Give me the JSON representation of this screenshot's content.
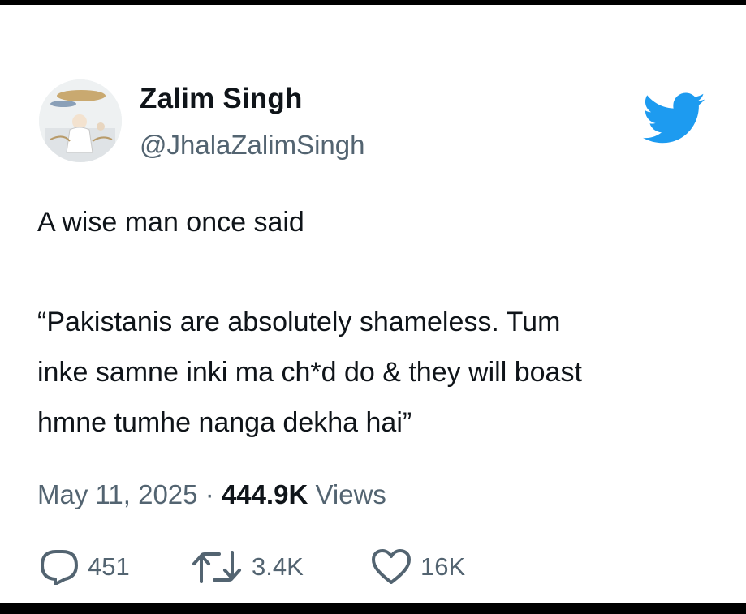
{
  "author": {
    "display_name": "Zalim Singh",
    "handle": "@JhalaZalimSingh",
    "avatar_icon": "avatar-painting"
  },
  "brand": {
    "icon": "twitter-bird-icon",
    "color": "#1d9bf0"
  },
  "tweet": {
    "lines": [
      "A wise man once said",
      "“Pakistanis are absolutely shameless. Tum",
      "inke samne inki ma ch*d do & they will boast",
      "hmne tumhe nanga dekha hai”"
    ]
  },
  "meta": {
    "date": "May 11, 2025",
    "separator": "·",
    "views_count": "444.9K",
    "views_label": "Views"
  },
  "actions": {
    "replies": "451",
    "retweets": "3.4K",
    "likes": "16K"
  },
  "colors": {
    "text_primary": "#0f1419",
    "text_secondary": "#536471",
    "frame": "#000000",
    "background": "#ffffff"
  }
}
